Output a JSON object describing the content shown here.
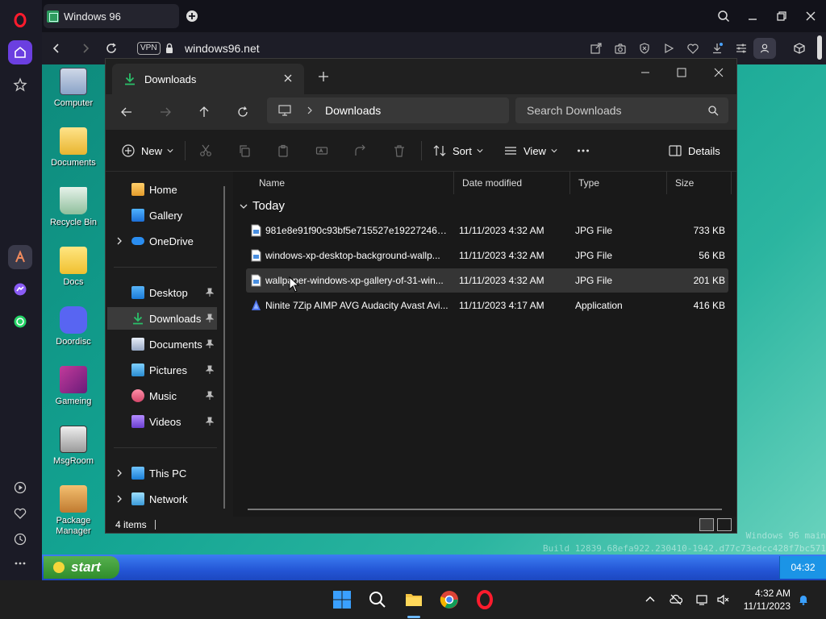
{
  "browser": {
    "tab_title": "Windows 96",
    "vpn_label": "VPN",
    "url": "windows96.net",
    "accent": "#ff1b2d"
  },
  "desktop": {
    "icons": [
      {
        "label": "Computer"
      },
      {
        "label": "Documents"
      },
      {
        "label": "Recycle Bin"
      },
      {
        "label": "Docs"
      },
      {
        "label": "Doordisc"
      },
      {
        "label": "Gameing"
      },
      {
        "label": "MsgRoom"
      },
      {
        "label": "Package Manager"
      }
    ],
    "watermark_line1": "Windows 96 main",
    "watermark_line2": "Build 12839.68efa922.230410-1942.d77c73edcc428f7bc571",
    "start_label": "start",
    "clock": "04:32"
  },
  "explorer": {
    "tab_label": "Downloads",
    "breadcrumb": "Downloads",
    "search_placeholder": "Search Downloads",
    "toolbar": {
      "new_label": "New",
      "sort_label": "Sort",
      "view_label": "View",
      "details_label": "Details"
    },
    "nav": {
      "home": "Home",
      "gallery": "Gallery",
      "onedrive": "OneDrive",
      "desktop": "Desktop",
      "downloads": "Downloads",
      "documents": "Documents",
      "pictures": "Pictures",
      "music": "Music",
      "videos": "Videos",
      "thispc": "This PC",
      "network": "Network"
    },
    "columns": {
      "name": "Name",
      "date": "Date modified",
      "type": "Type",
      "size": "Size"
    },
    "group_label": "Today",
    "files": [
      {
        "name": "981e8e91f90c93bf5e715527e1922724645f1...",
        "date": "11/11/2023 4:32 AM",
        "type": "JPG File",
        "size": "733 KB"
      },
      {
        "name": "windows-xp-desktop-background-wallp...",
        "date": "11/11/2023 4:32 AM",
        "type": "JPG File",
        "size": "56 KB"
      },
      {
        "name": "wallpaper-windows-xp-gallery-of-31-win...",
        "date": "11/11/2023 4:32 AM",
        "type": "JPG File",
        "size": "201 KB"
      },
      {
        "name": "Ninite 7Zip AIMP AVG Audacity Avast Avi...",
        "date": "11/11/2023 4:17 AM",
        "type": "Application",
        "size": "416 KB"
      }
    ],
    "status": "4 items"
  },
  "taskbar": {
    "time": "4:32 AM",
    "date": "11/11/2023"
  }
}
